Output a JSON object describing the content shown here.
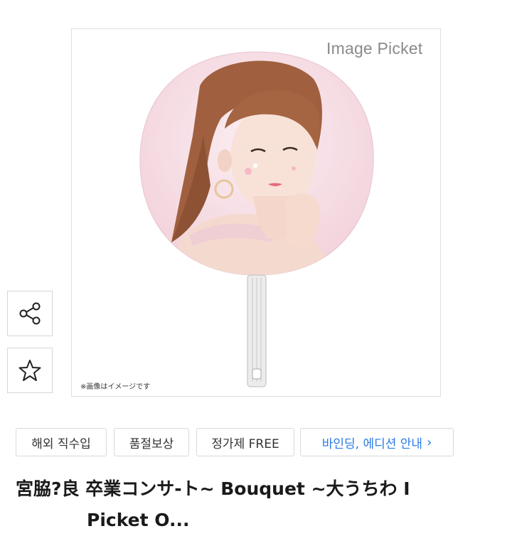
{
  "product_image": {
    "watermark": "Image Picket",
    "disclaimer": "※画像はイメージです",
    "colors": {
      "fan_bg": "#f6dde4",
      "hair": "#a0603f",
      "skin": "#f6dcd0",
      "handle": "#e8e8e8"
    }
  },
  "side_actions": {
    "share_icon": "share-icon",
    "favorite_icon": "star-icon"
  },
  "tags": [
    {
      "label": "해외 직수입"
    },
    {
      "label": "품절보상"
    },
    {
      "label": "정가제 FREE"
    },
    {
      "label": "바인딩, 에디션 안내",
      "chevron": "›"
    }
  ],
  "product": {
    "title": "宮脇?良 卒業コンサ-ト~ Bouquet ~大うちわ I",
    "title_line2": "Picket O..."
  }
}
